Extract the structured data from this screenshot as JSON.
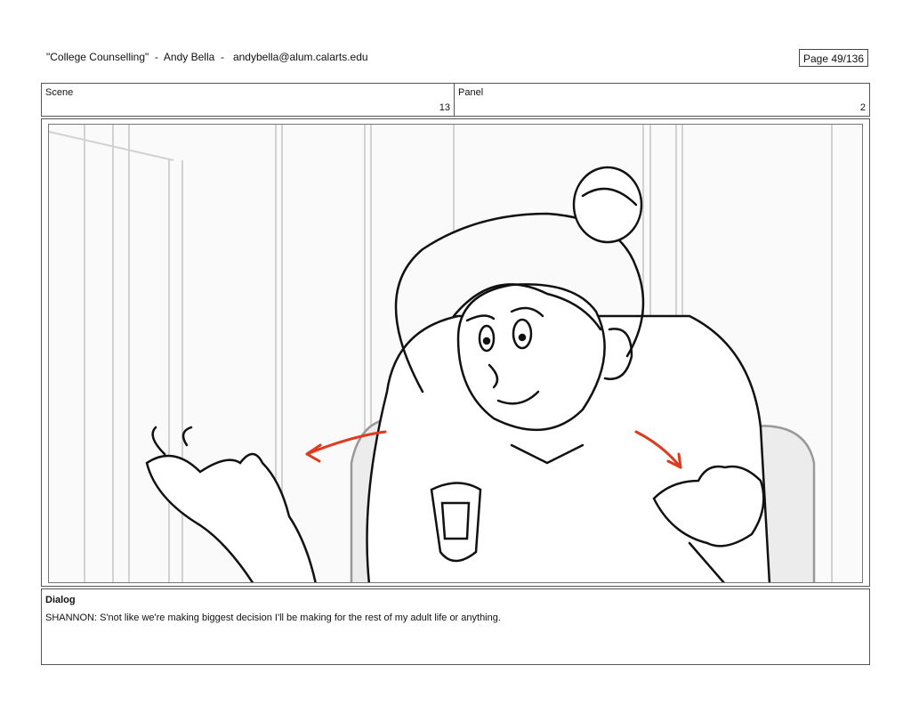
{
  "header": {
    "title": "\"College Counselling\"  -  Andy Bella  -   andybella@alum.calarts.edu",
    "page": "Page  49/136"
  },
  "scene": {
    "label": "Scene",
    "value": "13"
  },
  "panel": {
    "label": "Panel",
    "value": "2"
  },
  "dialog": {
    "label": "Dialog",
    "text": "SHANNON: S'not like we're making biggest decision I'll be making for the rest of my adult life or anything."
  },
  "colors": {
    "arrow": "#e0391b",
    "line": "#111111",
    "background_lines": "#d0d0d0"
  }
}
